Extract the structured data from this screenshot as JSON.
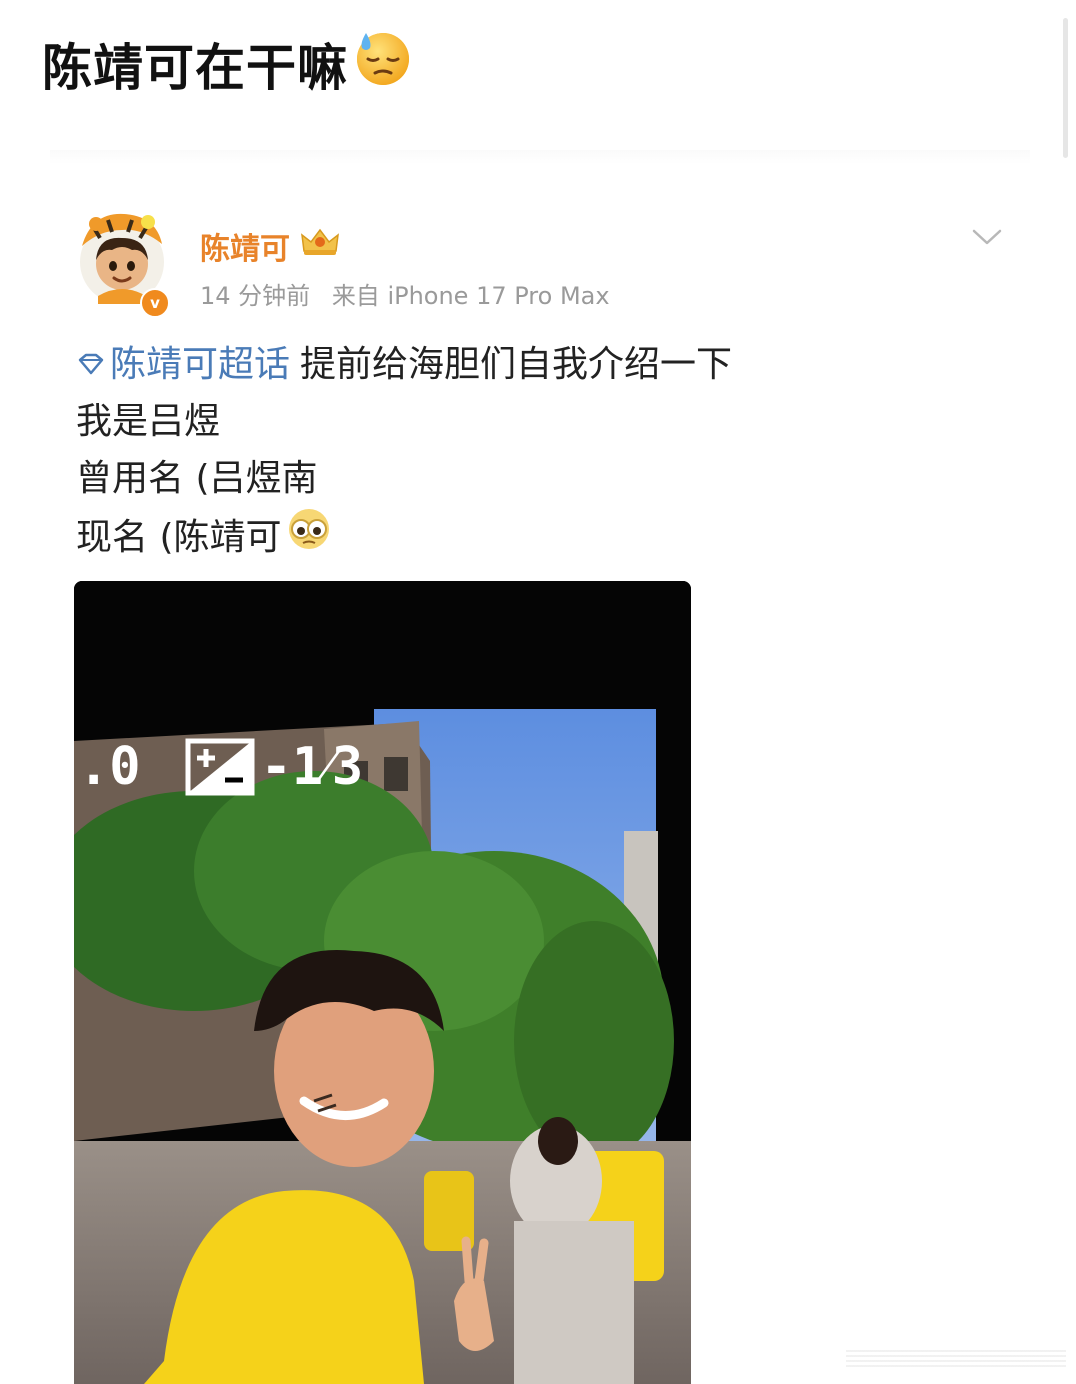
{
  "page": {
    "title": "陈靖可在干嘛",
    "title_emoji": "downcast-face-with-sweat-emoji"
  },
  "post": {
    "author": {
      "name": "陈靖可",
      "avatar": "tiger-hat-cartoon-avatar",
      "verified_badge": "v",
      "badge": "crown-vip-badge"
    },
    "time": "14 分钟前",
    "source": "来自 iPhone 17 Pro Max",
    "menu_icon": "chevron-down-icon",
    "topic": {
      "icon": "diamond-icon",
      "label": "陈靖可超话"
    },
    "lines": [
      "提前给海胆们自我介绍一下",
      "我是吕煜",
      "曾用名 (吕煜南",
      "现名 (陈靖可"
    ],
    "trailing_emoji": "teary-eyes-emoji",
    "image": {
      "overlay_left": ".0",
      "overlay_exposure": "-1⁄3"
    }
  },
  "colors": {
    "username": "#e8832a",
    "topic_link": "#4a7bb7",
    "meta": "#9a9a9a",
    "hoodie": "#f5d21a"
  }
}
